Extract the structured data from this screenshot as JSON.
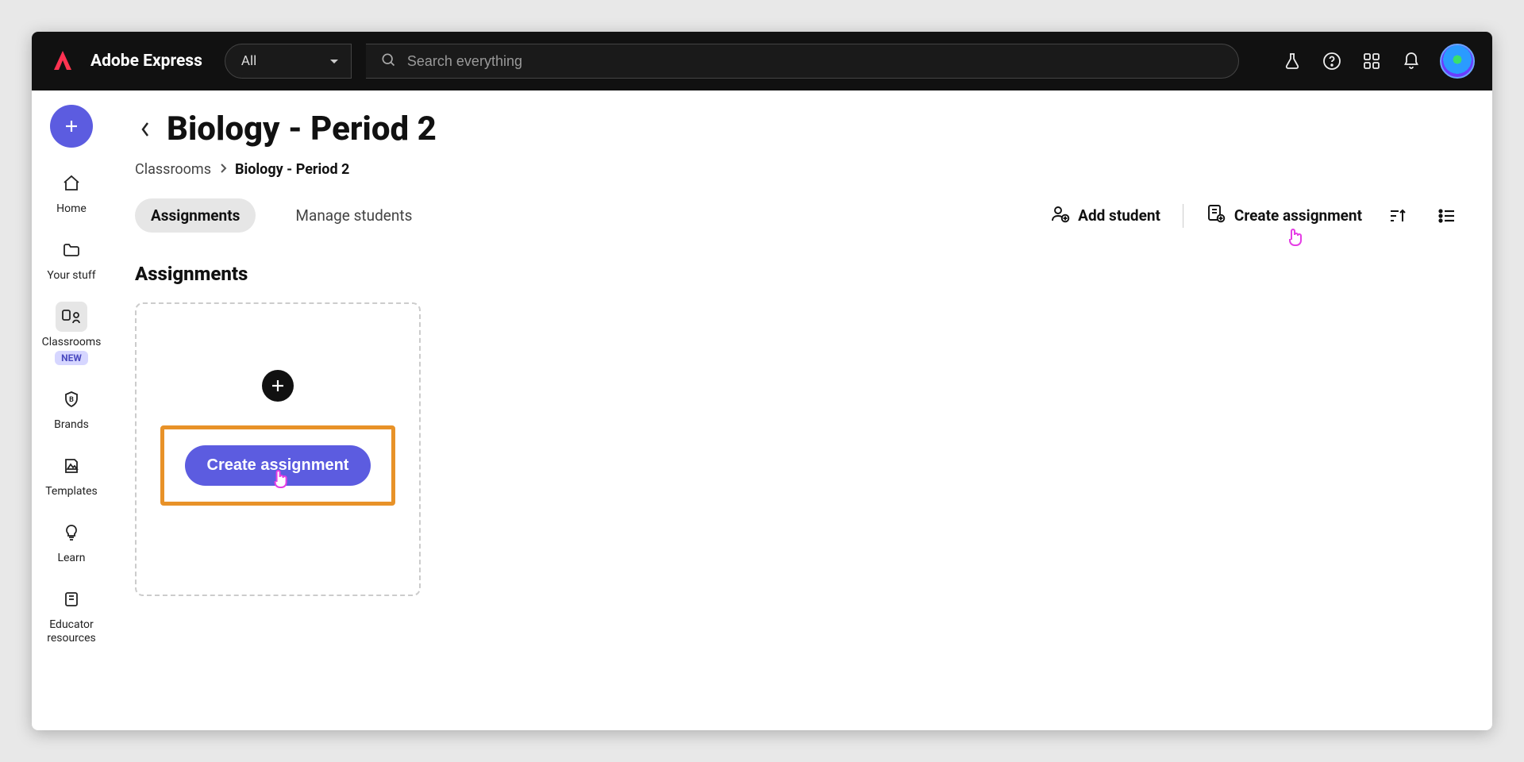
{
  "brand": {
    "name": "Adobe Express"
  },
  "search": {
    "scope": "All",
    "placeholder": "Search everything"
  },
  "sidebar": {
    "items": [
      {
        "label": "Home"
      },
      {
        "label": "Your stuff"
      },
      {
        "label": "Classrooms",
        "badge": "NEW"
      },
      {
        "label": "Brands"
      },
      {
        "label": "Templates"
      },
      {
        "label": "Learn"
      },
      {
        "label": "Educator resources"
      }
    ]
  },
  "page": {
    "title": "Biology - Period 2",
    "breadcrumb": {
      "root": "Classrooms",
      "current": "Biology - Period 2"
    }
  },
  "tabs": {
    "assignments": "Assignments",
    "manage_students": "Manage students"
  },
  "actions": {
    "add_student": "Add student",
    "create_assignment": "Create assignment"
  },
  "section": {
    "title": "Assignments"
  },
  "card": {
    "create_label": "Create assignment"
  }
}
